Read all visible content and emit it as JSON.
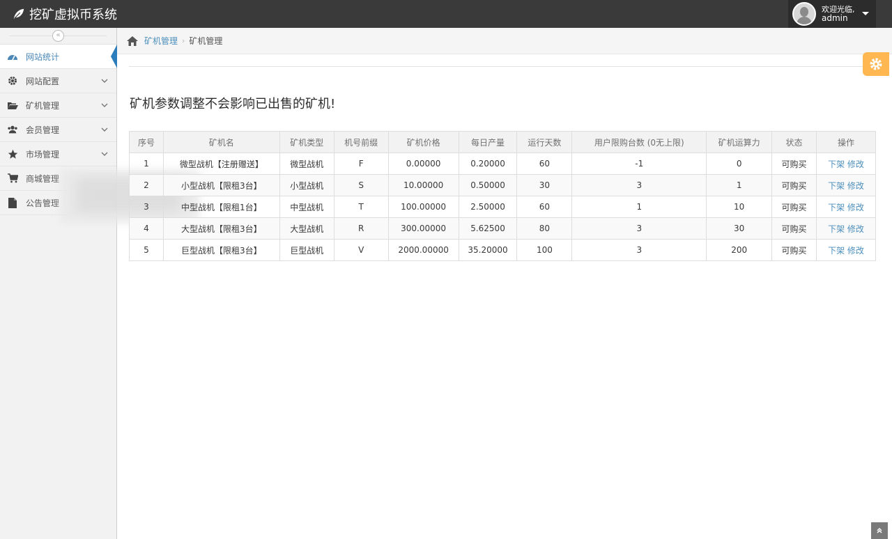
{
  "app": {
    "title": "挖矿虚拟币系统",
    "welcome": "欢迎光临,",
    "username": "admin"
  },
  "sidebar": {
    "items": [
      {
        "label": "网站统计",
        "icon": "dashboard-icon",
        "active": true
      },
      {
        "label": "网站配置",
        "icon": "gear-icon"
      },
      {
        "label": "矿机管理",
        "icon": "folder-open-icon"
      },
      {
        "label": "会员管理",
        "icon": "users-icon"
      },
      {
        "label": "市场管理",
        "icon": "star-icon"
      },
      {
        "label": "商城管理",
        "icon": "cart-icon"
      },
      {
        "label": "公告管理",
        "icon": "file-icon"
      }
    ]
  },
  "breadcrumb": {
    "link": "矿机管理",
    "current": "矿机管理"
  },
  "main": {
    "heading": "矿机参数调整不会影响已出售的矿机!"
  },
  "table": {
    "headers": [
      "序号",
      "矿机名",
      "矿机类型",
      "机号前缀",
      "矿机价格",
      "每日产量",
      "运行天数",
      "用户限购台数 (0无上限)",
      "矿机运算力",
      "状态",
      "操作"
    ],
    "rows": [
      {
        "no": "1",
        "name": "微型战机【注册赠送】",
        "type": "微型战机",
        "prefix": "F",
        "price": "0.00000",
        "daily": "0.20000",
        "days": "60",
        "limit": "-1",
        "power": "0",
        "status": "可购买",
        "action_down": "下架",
        "action_edit": "修改"
      },
      {
        "no": "2",
        "name": "小型战机【限租3台】",
        "type": "小型战机",
        "prefix": "S",
        "price": "10.00000",
        "daily": "0.50000",
        "days": "30",
        "limit": "3",
        "power": "1",
        "status": "可购买",
        "action_down": "下架",
        "action_edit": "修改"
      },
      {
        "no": "3",
        "name": "中型战机【限租1台】",
        "type": "中型战机",
        "prefix": "T",
        "price": "100.00000",
        "daily": "2.50000",
        "days": "60",
        "limit": "1",
        "power": "10",
        "status": "可购买",
        "action_down": "下架",
        "action_edit": "修改"
      },
      {
        "no": "4",
        "name": "大型战机【限租3台】",
        "type": "大型战机",
        "prefix": "R",
        "price": "300.00000",
        "daily": "5.62500",
        "days": "80",
        "limit": "3",
        "power": "30",
        "status": "可购买",
        "action_down": "下架",
        "action_edit": "修改"
      },
      {
        "no": "5",
        "name": "巨型战机【限租3台】",
        "type": "巨型战机",
        "prefix": "V",
        "price": "2000.00000",
        "daily": "35.20000",
        "days": "100",
        "limit": "3",
        "power": "200",
        "status": "可购买",
        "action_down": "下架",
        "action_edit": "修改"
      }
    ]
  },
  "colors": {
    "navbar": "#3a3a3a",
    "link": "#4c8fbd",
    "status_green": "#629b58",
    "active_arrow": "#2b7dbc",
    "settings_orange": "#ffb752"
  }
}
